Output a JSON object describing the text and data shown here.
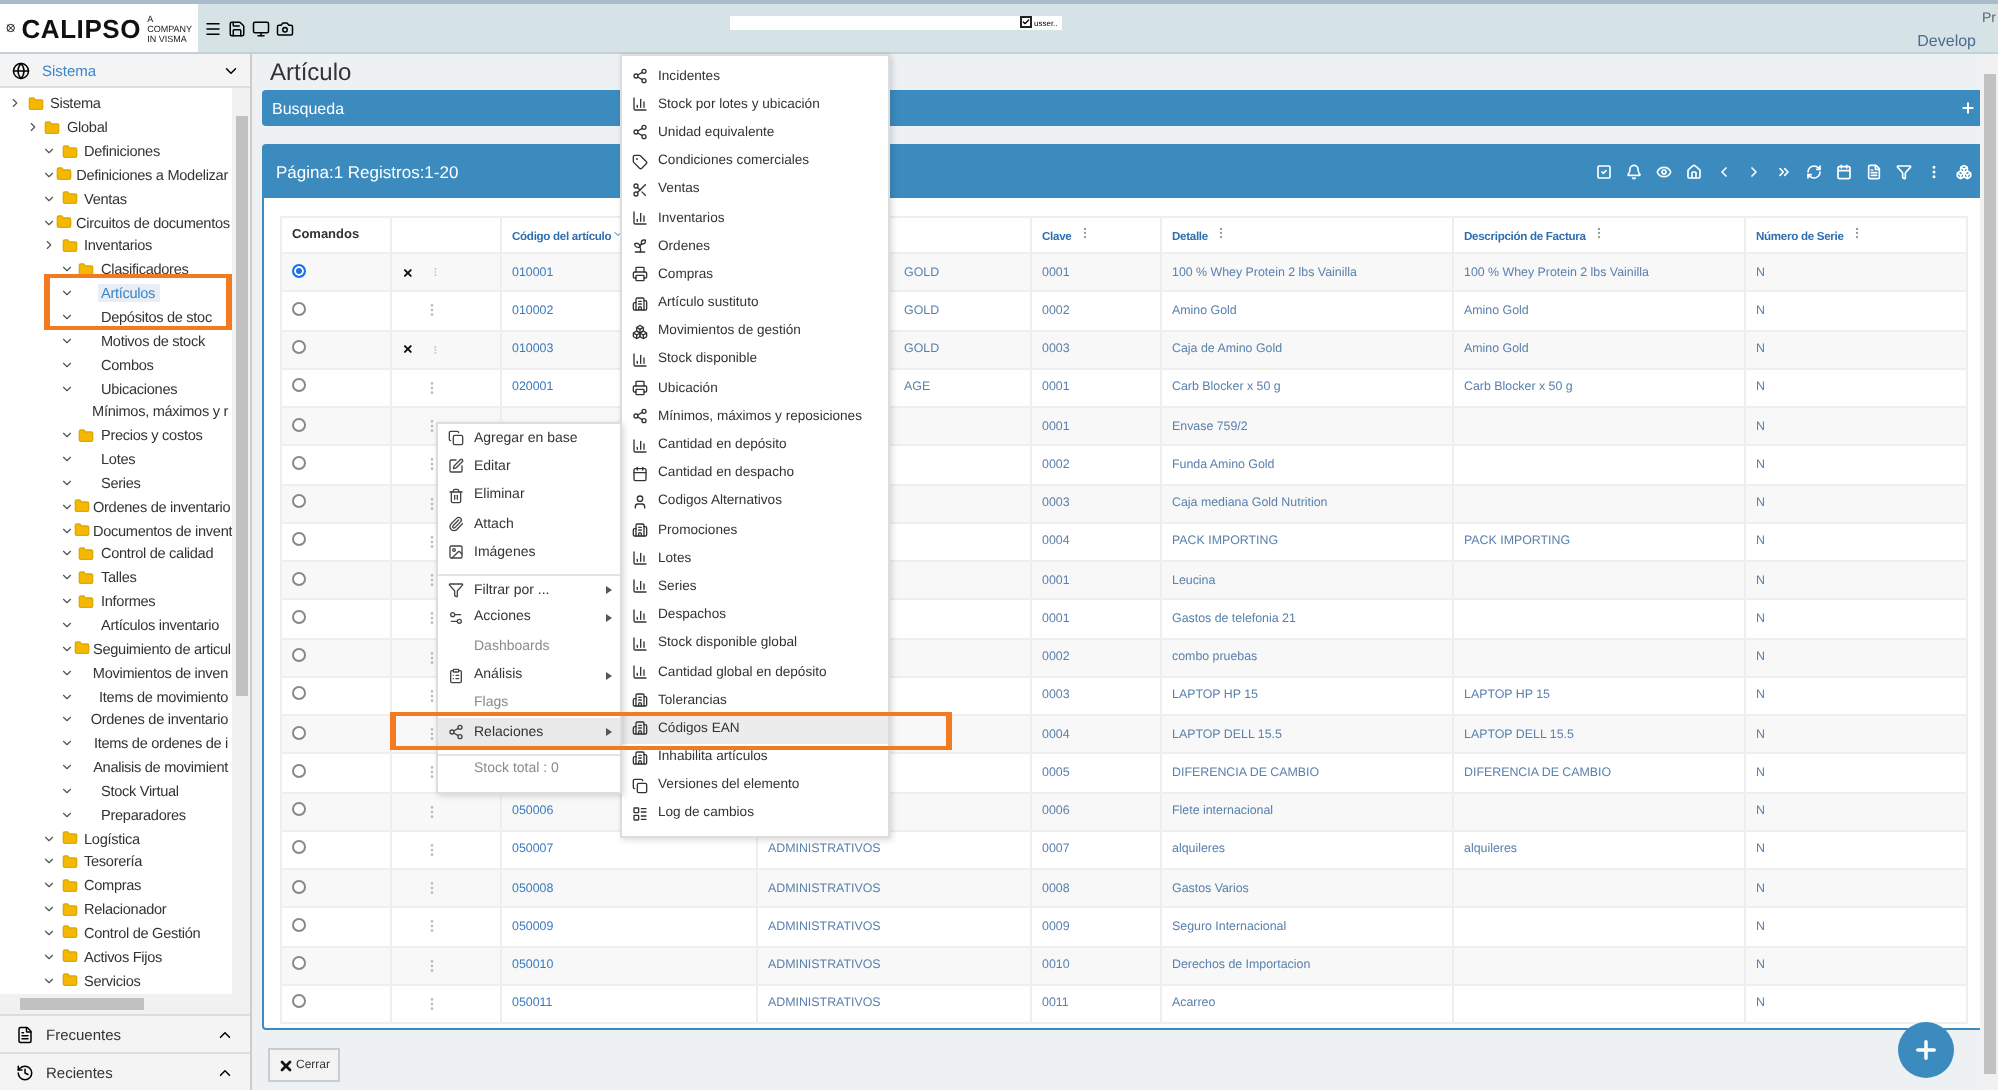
{
  "header": {
    "brand": "CALIPSO",
    "tagline_1": "A COMPANY",
    "tagline_2": "IN VISMA",
    "user_toggle": {
      "checked": true,
      "label": "usser.."
    },
    "env_link": "Develop",
    "broken_image_alt": "Pr"
  },
  "sidebar": {
    "section": "Sistema",
    "tree": [
      {
        "label": "Sistema",
        "folder": true,
        "expanded": false,
        "selected": false,
        "children": [
          {
            "label": "Global",
            "folder": true,
            "expanded": false,
            "selected": false,
            "children": [
              {
                "label": "Definiciones",
                "folder": true,
                "expanded": true,
                "selected": false
              },
              {
                "label": "Definiciones a Modelizar",
                "folder": true,
                "expanded": true,
                "selected": false
              },
              {
                "label": "Ventas",
                "folder": true,
                "expanded": true,
                "selected": false
              },
              {
                "label": "Circuitos de documentos",
                "folder": true,
                "expanded": true,
                "selected": false
              },
              {
                "label": "Inventarios",
                "folder": true,
                "expanded": false,
                "selected": false,
                "children": [
                  {
                    "label": "Clasificadores",
                    "folder": true,
                    "expanded": true,
                    "selected": false
                  },
                  {
                    "label": "Artículos",
                    "folder": false,
                    "expanded": true,
                    "selected": true
                  },
                  {
                    "label": "Depósitos de stoc",
                    "folder": false,
                    "expanded": true,
                    "selected": false
                  },
                  {
                    "label": "Motivos de stock",
                    "folder": false,
                    "expanded": true,
                    "selected": false
                  },
                  {
                    "label": "Combos",
                    "folder": false,
                    "expanded": true,
                    "selected": false
                  },
                  {
                    "label": "Ubicaciones",
                    "folder": false,
                    "expanded": true,
                    "selected": false
                  },
                  {
                    "label": "Mínimos, máximos y r",
                    "folder": false,
                    "selected": false
                  },
                  {
                    "label": "Precios y costos",
                    "folder": true,
                    "expanded": true,
                    "selected": false
                  },
                  {
                    "label": "Lotes",
                    "folder": false,
                    "expanded": true,
                    "selected": false
                  },
                  {
                    "label": "Series",
                    "folder": false,
                    "expanded": true,
                    "selected": false
                  },
                  {
                    "label": "Ordenes de inventario",
                    "folder": true,
                    "expanded": true,
                    "selected": false
                  },
                  {
                    "label": "Documentos de invent",
                    "folder": true,
                    "expanded": true,
                    "selected": false
                  },
                  {
                    "label": "Control de calidad",
                    "folder": true,
                    "expanded": true,
                    "selected": false
                  },
                  {
                    "label": "Talles",
                    "folder": true,
                    "expanded": true,
                    "selected": false
                  },
                  {
                    "label": "Informes",
                    "folder": true,
                    "expanded": true,
                    "selected": false
                  },
                  {
                    "label": "Artículos inventario",
                    "folder": false,
                    "expanded": true,
                    "selected": false
                  },
                  {
                    "label": "Seguimiento de articul",
                    "folder": true,
                    "expanded": true,
                    "selected": false
                  },
                  {
                    "label": "Movimientos de inven",
                    "folder": false,
                    "expanded": true,
                    "selected": false
                  },
                  {
                    "label": "Items de movimiento",
                    "folder": false,
                    "expanded": true,
                    "selected": false
                  },
                  {
                    "label": "Ordenes de inventario",
                    "folder": false,
                    "expanded": true,
                    "selected": false
                  },
                  {
                    "label": "Items de ordenes de i",
                    "folder": false,
                    "expanded": true,
                    "selected": false
                  },
                  {
                    "label": "Analisis de movimient",
                    "folder": false,
                    "expanded": true,
                    "selected": false
                  },
                  {
                    "label": "Stock Virtual",
                    "folder": false,
                    "expanded": true,
                    "selected": false
                  },
                  {
                    "label": "Preparadores",
                    "folder": false,
                    "expanded": true,
                    "selected": false
                  }
                ]
              },
              {
                "label": "Logística",
                "folder": true,
                "expanded": true,
                "selected": false
              },
              {
                "label": "Tesorería",
                "folder": true,
                "expanded": true,
                "selected": false
              },
              {
                "label": "Compras",
                "folder": true,
                "expanded": true,
                "selected": false
              },
              {
                "label": "Relacionador",
                "folder": true,
                "expanded": true,
                "selected": false
              },
              {
                "label": "Control de Gestión",
                "folder": true,
                "expanded": true,
                "selected": false
              },
              {
                "label": "Activos Fijos",
                "folder": true,
                "expanded": true,
                "selected": false
              },
              {
                "label": "Servicios",
                "folder": true,
                "expanded": true,
                "selected": false
              }
            ]
          }
        ]
      }
    ],
    "bottom_panels": [
      "Frecuentes",
      "Recientes"
    ]
  },
  "page": {
    "title": "Artículo",
    "search_panel": "Busqueda",
    "list_panel": "Página:1 Registros:1-20",
    "columns": [
      "Comandos",
      "",
      "Código del artículo",
      "",
      "Clave",
      "Detalle",
      "Descripción de Factura",
      "Número de Serie"
    ],
    "rows": [
      {
        "selected": true,
        "x_mark": true,
        "code": "010001",
        "column_4": "GOLD",
        "column_4_cut": true,
        "clave": "0001",
        "detalle": "100 % Whey Protein 2 lbs Vainilla",
        "descripcion": "100 % Whey Protein 2 lbs Vainilla",
        "serie": "N"
      },
      {
        "selected": false,
        "x_mark": false,
        "code": "010002",
        "column_4": "GOLD",
        "column_4_cut": true,
        "clave": "0002",
        "detalle": "Amino Gold",
        "descripcion": "Amino Gold",
        "serie": "N"
      },
      {
        "selected": false,
        "x_mark": true,
        "code": "010003",
        "column_4": "GOLD",
        "column_4_cut": true,
        "clave": "0003",
        "detalle": "Caja de Amino Gold",
        "descripcion": "Amino Gold",
        "serie": "N"
      },
      {
        "selected": false,
        "x_mark": false,
        "code": "020001",
        "column_4": "AGE",
        "column_4_cut": true,
        "clave": "0001",
        "detalle": "Carb Blocker x 50 g",
        "descripcion": "Carb Blocker x 50 g",
        "serie": "N"
      },
      {
        "selected": false,
        "x_mark": false,
        "clave": "0001",
        "detalle": "Envase 759/2",
        "serie": "N"
      },
      {
        "selected": false,
        "x_mark": false,
        "clave": "0002",
        "detalle": "Funda Amino Gold",
        "serie": "N"
      },
      {
        "selected": false,
        "x_mark": false,
        "clave": "0003",
        "detalle": "Caja mediana Gold Nutrition",
        "serie": "N"
      },
      {
        "selected": false,
        "x_mark": false,
        "clave": "0004",
        "detalle": "PACK IMPORTING",
        "descripcion": "PACK IMPORTING",
        "serie": "N"
      },
      {
        "selected": false,
        "x_mark": false,
        "clave": "0001",
        "detalle": "Leucina",
        "serie": "N"
      },
      {
        "selected": false,
        "x_mark": false,
        "clave": "0001",
        "detalle": "Gastos de telefonia 21",
        "serie": "N"
      },
      {
        "selected": false,
        "x_mark": false,
        "clave": "0002",
        "detalle": "combo pruebas",
        "serie": "N"
      },
      {
        "selected": false,
        "x_mark": false,
        "clave": "0003",
        "detalle": "LAPTOP HP 15",
        "descripcion": "LAPTOP HP 15",
        "serie": "N"
      },
      {
        "selected": false,
        "x_mark": false,
        "clave": "0004",
        "detalle": "LAPTOP DELL 15.5",
        "descripcion": "LAPTOP DELL 15.5",
        "serie": "N"
      },
      {
        "selected": false,
        "x_mark": false,
        "clave": "0005",
        "detalle": "DIFERENCIA DE CAMBIO",
        "descripcion": "DIFERENCIA DE CAMBIO",
        "serie": "N"
      },
      {
        "selected": false,
        "x_mark": false,
        "code": "050006",
        "clave": "0006",
        "detalle": "Flete internacional",
        "serie": "N"
      },
      {
        "selected": false,
        "x_mark": false,
        "code": "050007",
        "column_4": "ADMINISTRATIVOS",
        "clave": "0007",
        "detalle": "alquileres",
        "descripcion": "alquileres",
        "serie": "N"
      },
      {
        "selected": false,
        "x_mark": false,
        "code": "050008",
        "column_4": "ADMINISTRATIVOS",
        "clave": "0008",
        "detalle": "Gastos Varios",
        "serie": "N"
      },
      {
        "selected": false,
        "x_mark": false,
        "code": "050009",
        "column_4": "ADMINISTRATIVOS",
        "clave": "0009",
        "detalle": "Seguro Internacional",
        "serie": "N"
      },
      {
        "selected": false,
        "x_mark": false,
        "code": "050010",
        "column_4": "ADMINISTRATIVOS",
        "clave": "0010",
        "detalle": "Derechos de Importacion",
        "serie": "N"
      },
      {
        "selected": false,
        "x_mark": false,
        "code": "050011",
        "column_4": "ADMINISTRATIVOS",
        "clave": "0011",
        "detalle": "Acarreo",
        "serie": "N"
      }
    ],
    "close_button": "Cerrar"
  },
  "context_menu": [
    {
      "label": "Agregar en base",
      "kind": "item",
      "disabled": false,
      "selected": false,
      "separated": false
    },
    {
      "label": "Editar",
      "kind": "item",
      "disabled": false,
      "selected": false,
      "separated": false
    },
    {
      "label": "Eliminar",
      "kind": "item",
      "disabled": false,
      "selected": false,
      "separated": false
    },
    {
      "label": "Attach",
      "kind": "item",
      "disabled": false,
      "selected": false,
      "separated": false
    },
    {
      "label": "Imágenes",
      "kind": "item",
      "disabled": false,
      "selected": false,
      "separated": false
    },
    {
      "label": "Filtrar por ...",
      "kind": "submenu",
      "disabled": false,
      "selected": false,
      "separated": true
    },
    {
      "label": "Acciones",
      "kind": "submenu",
      "disabled": false,
      "selected": false,
      "separated": false
    },
    {
      "label": "Dashboards",
      "kind": "item",
      "disabled": true,
      "selected": false,
      "separated": false
    },
    {
      "label": "Análisis",
      "kind": "submenu",
      "disabled": false,
      "selected": false,
      "separated": false
    },
    {
      "label": "Flags",
      "kind": "item",
      "disabled": true,
      "selected": false,
      "separated": false
    },
    {
      "label": "Relaciones",
      "kind": "submenu",
      "disabled": false,
      "selected": true,
      "separated": false
    },
    {
      "label": "Stock total : 0",
      "kind": "item",
      "disabled": true,
      "selected": false,
      "separated": true
    }
  ],
  "relations_menu": [
    {
      "label": "Incidentes",
      "selected": false
    },
    {
      "label": "Stock por lotes y ubicación",
      "selected": false
    },
    {
      "label": "Unidad equivalente",
      "selected": false
    },
    {
      "label": "Condiciones comerciales",
      "selected": false
    },
    {
      "label": "Ventas",
      "selected": false
    },
    {
      "label": "Inventarios",
      "selected": false
    },
    {
      "label": "Ordenes",
      "selected": false
    },
    {
      "label": "Compras",
      "selected": false
    },
    {
      "label": "Artículo sustituto",
      "selected": false
    },
    {
      "label": "Movimientos de gestión",
      "selected": false
    },
    {
      "label": "Stock disponible",
      "selected": false
    },
    {
      "label": "Ubicación",
      "selected": false
    },
    {
      "label": "Mínimos, máximos y reposiciones",
      "selected": false
    },
    {
      "label": "Cantidad en depósito",
      "selected": false
    },
    {
      "label": "Cantidad en despacho",
      "selected": false
    },
    {
      "label": "Codigos Alternativos",
      "selected": false
    },
    {
      "label": "Promociones",
      "selected": false
    },
    {
      "label": "Lotes",
      "selected": false
    },
    {
      "label": "Series",
      "selected": false
    },
    {
      "label": "Despachos",
      "selected": false
    },
    {
      "label": "Stock disponible global",
      "selected": false
    },
    {
      "label": "Cantidad global en depósito",
      "selected": false
    },
    {
      "label": "Tolerancias",
      "selected": false
    },
    {
      "label": "Códigos EAN",
      "selected": true
    },
    {
      "label": "Inhabilita artículos",
      "selected": false
    },
    {
      "label": "Versiones del elemento",
      "selected": false
    },
    {
      "label": "Log de cambios",
      "selected": false
    }
  ]
}
